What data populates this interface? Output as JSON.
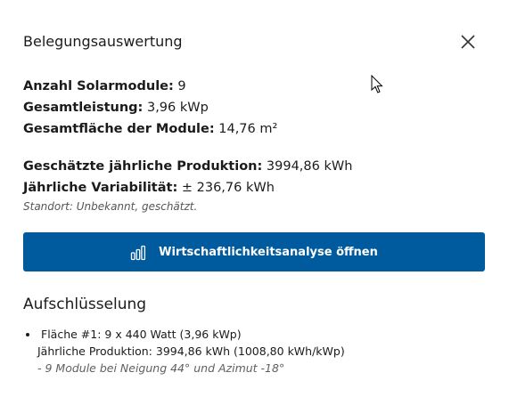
{
  "dialog": {
    "title": "Belegungsauswertung",
    "close_icon": "close-icon"
  },
  "stats": {
    "modules_label": "Anzahl Solarmodule:",
    "modules_value": "9",
    "power_label": "Gesamtleistung:",
    "power_value": "3,96 kWp",
    "area_label": "Gesamtfläche der Module:",
    "area_value": "14,76 m²"
  },
  "production": {
    "yearly_label": "Geschätzte jährliche Produktion:",
    "yearly_value": "3994,86 kWh",
    "variability_label": "Jährliche Variabilität:",
    "variability_value": "± 236,76 kWh",
    "location_note": "Standort: Unbekannt, geschätzt."
  },
  "cta": {
    "label": "Wirtschaftlichkeitsanalyse öffnen",
    "icon": "bar-chart-icon",
    "color": "#005a9e"
  },
  "breakdown": {
    "title": "Aufschlüsselung",
    "items": [
      {
        "line1": "Fläche #1: 9 x 440 Watt (3,96 kWp)",
        "line2": "Jährliche Produktion: 3994,86 kWh (1008,80 kWh/kWp)",
        "line3": "- 9 Module bei Neigung 44° und Azimut -18°"
      }
    ]
  }
}
